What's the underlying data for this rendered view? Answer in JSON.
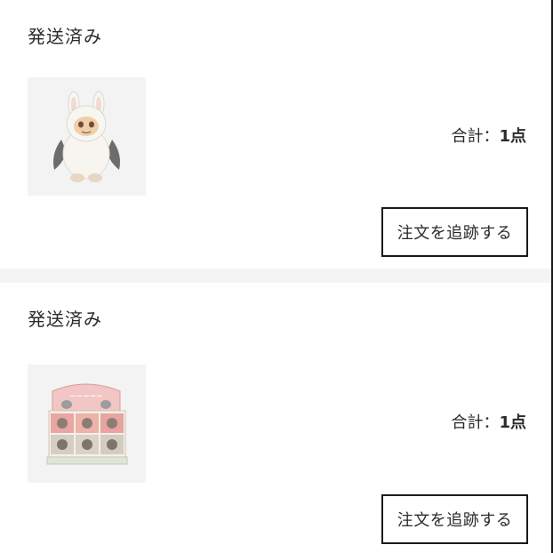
{
  "orders": [
    {
      "status": "発送済み",
      "product_image": "white-bunny-figure",
      "total_label": "合計：",
      "total_count": "1点",
      "track_button": "注文を追跡する"
    },
    {
      "status": "発送済み",
      "product_image": "blind-box-display-set",
      "total_label": "合計：",
      "total_count": "1点",
      "track_button": "注文を追跡する"
    }
  ],
  "colors": {
    "text": "#2b2b2b",
    "border": "#1a1a1a",
    "thumb_bg": "#f3f3f3",
    "divider": "#f4f4f4"
  }
}
